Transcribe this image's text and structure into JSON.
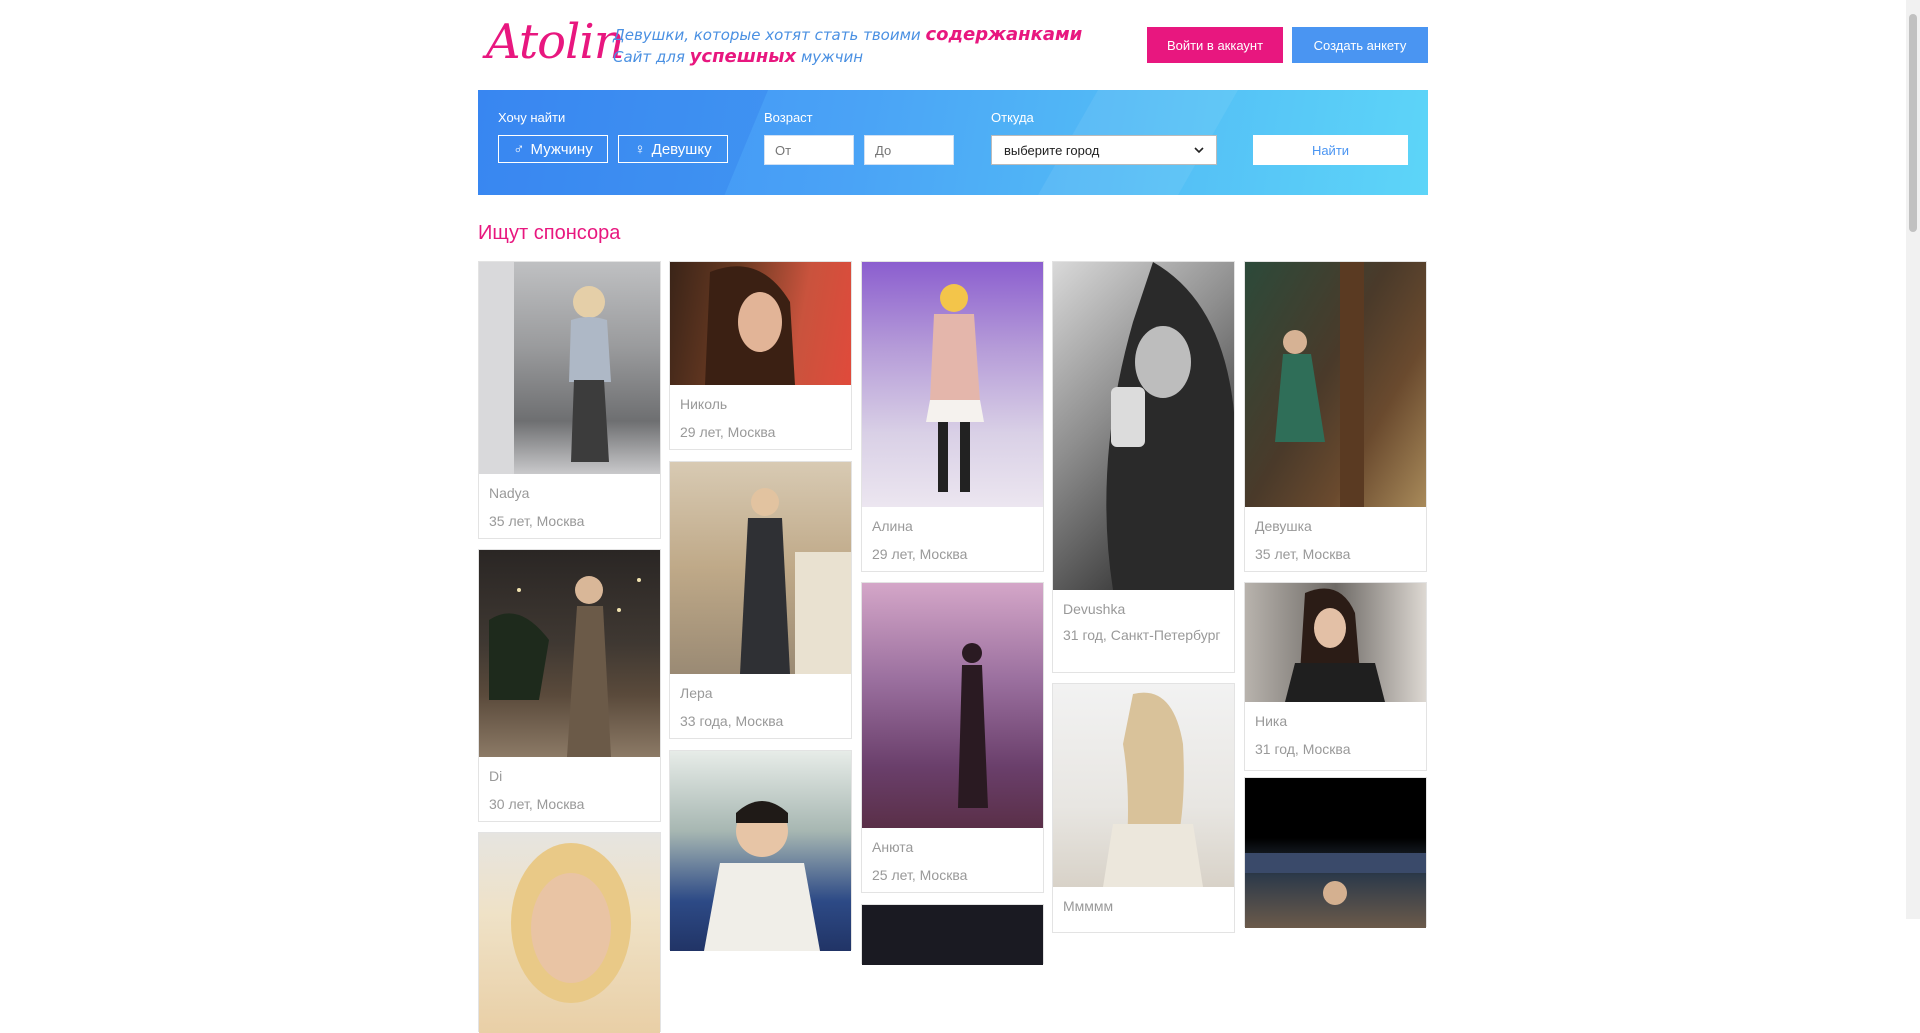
{
  "header": {
    "logo": "Atolin",
    "tagline_line1_pre": "Девушки, которые хотят стать твоими ",
    "tagline_line1_hl": "содержанками",
    "tagline_line2_pre": "Сайт для ",
    "tagline_line2_hl": "успешных",
    "tagline_line2_post": " мужчин",
    "login_label": "Войти в аккаунт",
    "create_label": "Создать анкету"
  },
  "search": {
    "want_label": "Хочу найти",
    "male_label": "Мужчину",
    "female_label": "Девушку",
    "age_label": "Возраст",
    "age_from_placeholder": "От",
    "age_to_placeholder": "До",
    "from_label": "Откуда",
    "city_selected": "выберите город",
    "find_label": "Найти"
  },
  "section_title": "Ищут спонсора",
  "cards": [
    {
      "name": "Nadya",
      "info": "35 лет, Москва"
    },
    {
      "name": "Di",
      "info": "30 лет, Москва"
    },
    {
      "name": "Николь",
      "info": "29 лет, Москва"
    },
    {
      "name": "Лера",
      "info": "33 года, Москва"
    },
    {
      "name": "Алина",
      "info": "29 лет, Москва"
    },
    {
      "name": "Анюта",
      "info": "25 лет, Москва"
    },
    {
      "name": "Devushka",
      "info": "31 год, Санкт-Петербург"
    },
    {
      "name": "Ммммм",
      "info": ""
    },
    {
      "name": "Девушка",
      "info": "35 лет, Москва"
    },
    {
      "name": "Ника",
      "info": "31 год, Москва"
    }
  ]
}
